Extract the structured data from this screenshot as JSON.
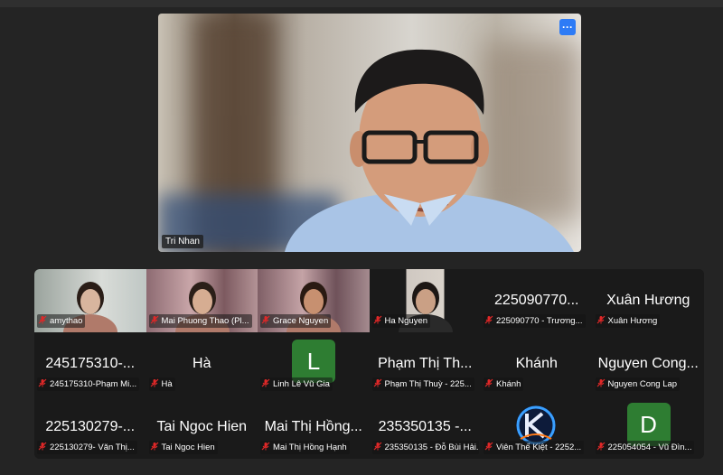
{
  "speaker": {
    "name": "Tri Nhan",
    "more_icon": "ellipsis-icon"
  },
  "colors": {
    "accent": "#2d7bf6",
    "avatar_green": "#2e7d32",
    "mic_muted": "#e02828"
  },
  "tiles": [
    {
      "big": "",
      "caption": "amythao",
      "type": "video"
    },
    {
      "big": "",
      "caption": "Mai Phuong Thao (Pl...",
      "type": "video"
    },
    {
      "big": "",
      "caption": "Grace Nguyen",
      "type": "video"
    },
    {
      "big": "",
      "caption": "Ha Nguyen",
      "type": "video"
    },
    {
      "big": "225090770...",
      "caption": "225090770 - Trương...",
      "type": "name"
    },
    {
      "big": "Xuân Hương",
      "caption": "Xuân Hương",
      "type": "name"
    },
    {
      "big": "245175310-...",
      "caption": "245175310-Phạm Mi...",
      "type": "name"
    },
    {
      "big": "Hà",
      "caption": "Hà",
      "type": "name"
    },
    {
      "big": "L",
      "caption": "Linh Lê Vũ Gia",
      "type": "avatar"
    },
    {
      "big": "Phạm Thị Th...",
      "caption": "Phạm Thị Thuỳ - 225...",
      "type": "name"
    },
    {
      "big": "Khánh",
      "caption": "Khánh",
      "type": "name"
    },
    {
      "big": "Nguyen Cong...",
      "caption": "Nguyen Cong Lap",
      "type": "name"
    },
    {
      "big": "225130279-...",
      "caption": "225130279- Văn Thị...",
      "type": "name"
    },
    {
      "big": "Tai Ngoc Hien",
      "caption": "Tai Ngoc Hien",
      "type": "name"
    },
    {
      "big": "Mai Thị Hồng...",
      "caption": "Mai Thị Hồng Hạnh",
      "type": "name"
    },
    {
      "big": "235350135 -...",
      "caption": "235350135 - Đỗ Bùi Hải...",
      "type": "name"
    },
    {
      "big": "",
      "caption": "Viên Thế Kiệt - 2252...",
      "type": "logo"
    },
    {
      "big": "D",
      "caption": "225054054 - Vũ Đìn...",
      "type": "avatar"
    }
  ]
}
